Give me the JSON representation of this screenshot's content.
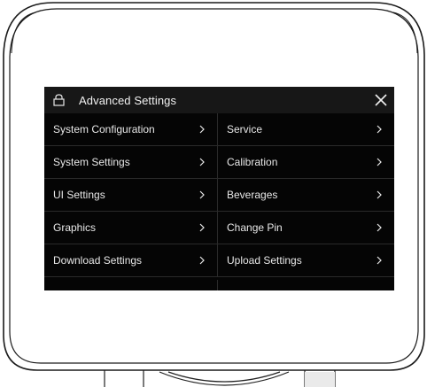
{
  "window": {
    "title": "Advanced Settings",
    "lock_icon": "lock-icon",
    "close_icon": "close-icon"
  },
  "menu": {
    "left": [
      {
        "label": "System Configuration"
      },
      {
        "label": "System Settings"
      },
      {
        "label": "UI Settings"
      },
      {
        "label": "Graphics"
      },
      {
        "label": "Download Settings"
      }
    ],
    "right": [
      {
        "label": "Service"
      },
      {
        "label": "Calibration"
      },
      {
        "label": "Beverages"
      },
      {
        "label": "Change Pin"
      },
      {
        "label": "Upload Settings"
      }
    ],
    "chevron_icon": "chevron-right-icon"
  },
  "colors": {
    "screen_background": "#050505",
    "titlebar_background": "#171717",
    "text": "#e8e8e8",
    "divider": "#2a2a2a"
  }
}
